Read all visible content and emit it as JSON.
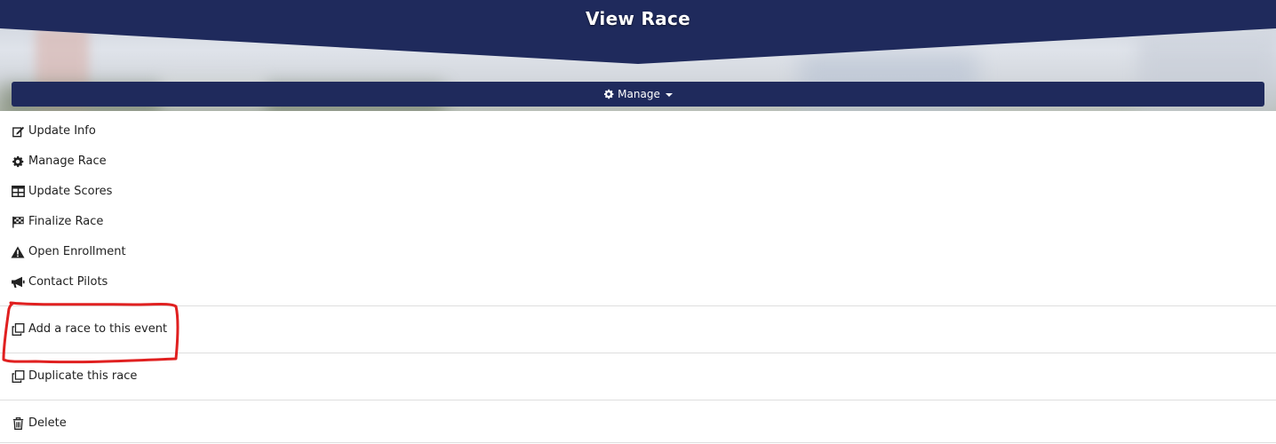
{
  "header": {
    "title": "View Race",
    "banner_color": "#1f2a5c"
  },
  "manage": {
    "label": "Manage",
    "icon": "gear-icon"
  },
  "menu": {
    "items": [
      {
        "label": "Update Info",
        "icon": "edit-icon"
      },
      {
        "label": "Manage Race",
        "icon": "gear-icon"
      },
      {
        "label": "Update Scores",
        "icon": "table-icon"
      },
      {
        "label": "Finalize Race",
        "icon": "checkered-flag-icon"
      },
      {
        "label": "Open Enrollment",
        "icon": "warning-icon"
      },
      {
        "label": "Contact Pilots",
        "icon": "megaphone-icon"
      }
    ],
    "add_race": {
      "label": "Add a race to this event",
      "icon": "clone-icon"
    },
    "duplicate": {
      "label": "Duplicate this race",
      "icon": "clone-icon"
    },
    "delete": {
      "label": "Delete",
      "icon": "trash-icon"
    }
  },
  "annotation": {
    "color": "#e02020"
  }
}
